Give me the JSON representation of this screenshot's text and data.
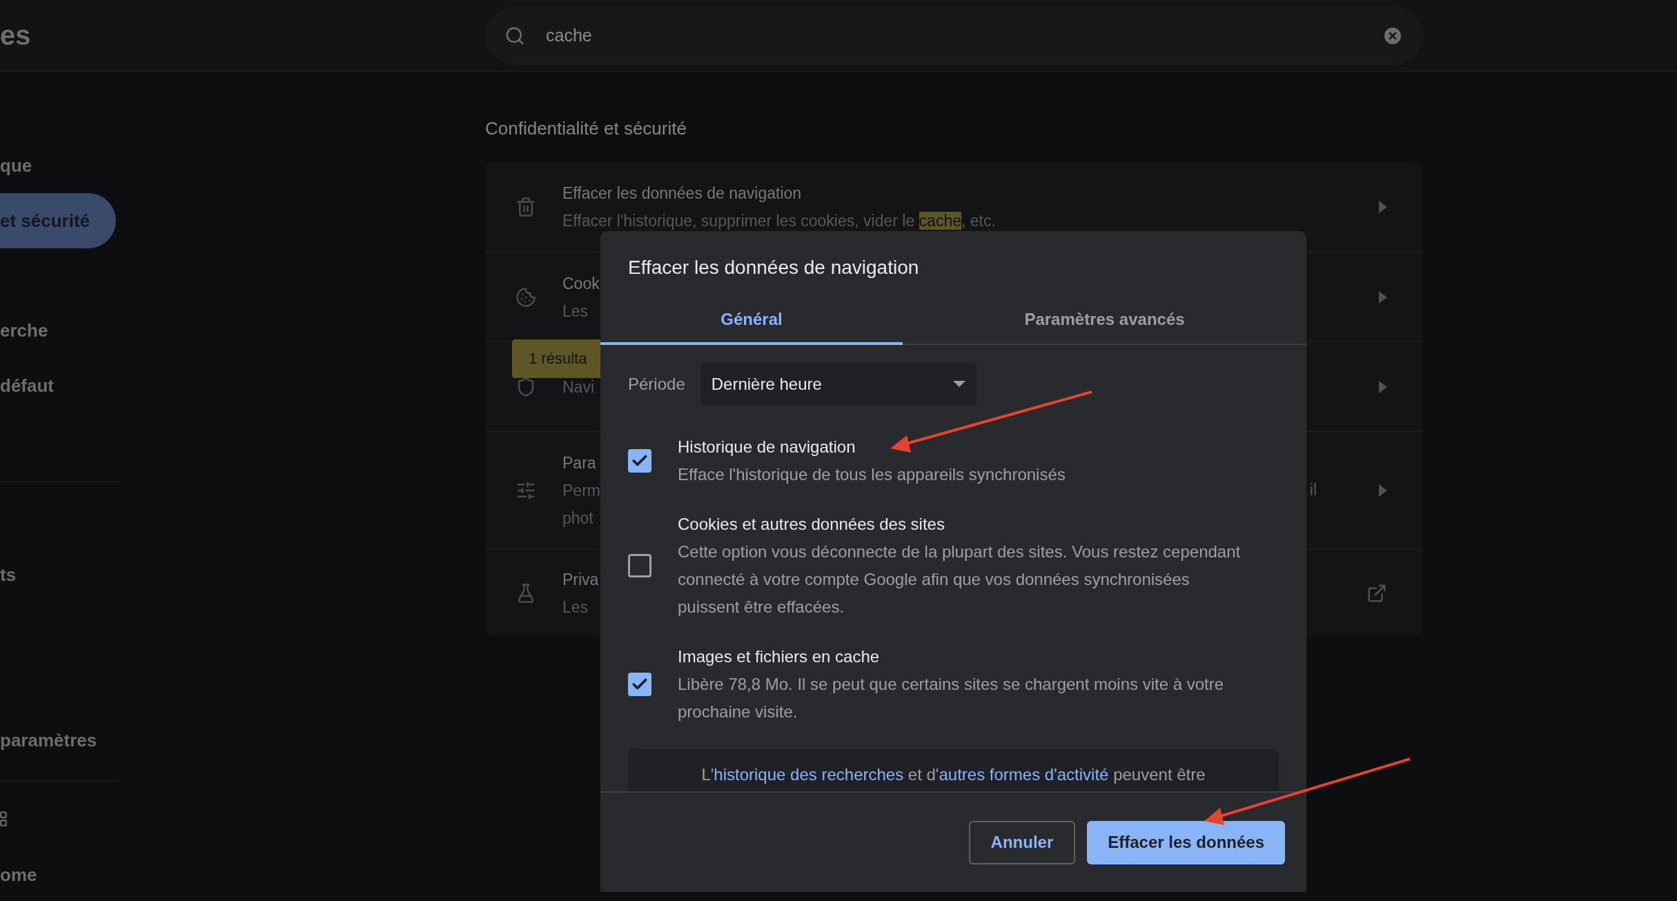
{
  "header": {
    "title": "es",
    "search": {
      "value": "cache"
    }
  },
  "sidebar": {
    "items": [
      {
        "kind": "text",
        "label": "que",
        "selected": false
      },
      {
        "kind": "text",
        "label": "et sécurité",
        "selected": true
      },
      {
        "kind": "text",
        "label": "erche",
        "selected": false
      },
      {
        "kind": "text",
        "label": "défaut",
        "selected": false
      },
      {
        "kind": "text",
        "label": "ts",
        "selected": false
      },
      {
        "kind": "text",
        "label": "paramètres",
        "selected": false
      },
      {
        "kind": "icon",
        "selected": false
      },
      {
        "kind": "text",
        "label": "ome",
        "selected": false
      }
    ]
  },
  "section": {
    "title": "Confidentialité et sécurité",
    "rows": [
      {
        "title": "Effacer les données de navigation",
        "lines": [
          "Effacer l'historique, supprimer les cookies, vider le **cache**, etc."
        ]
      },
      {
        "title": "Cook",
        "lines": [
          "Les"
        ]
      },
      {
        "lines": [
          "Navi"
        ]
      },
      {
        "title": "Para",
        "lines": [
          "Perm",
          "phot"
        ],
        "trailing_text": "il"
      },
      {
        "title": "Priva",
        "lines": [
          "Les"
        ]
      }
    ]
  },
  "search_bubble": {
    "text": "1 résulta"
  },
  "dialog": {
    "title": "Effacer les données de navigation",
    "tabs": [
      {
        "label": "Général",
        "selected": true
      },
      {
        "label": "Paramètres avancés",
        "selected": false
      }
    ],
    "period": {
      "label": "Période",
      "value": "Dernière heure"
    },
    "options": [
      {
        "title": "Historique de navigation",
        "description": "Efface l'historique de tous les appareils synchronisés",
        "checked": true
      },
      {
        "title": "Cookies et autres données des sites",
        "description": "Cette option vous déconnecte de la plupart des sites. Vous restez cependant connecté à votre compte Google afin que vos données synchronisées puissent être effacées.",
        "checked": false
      },
      {
        "title": "Images et fichiers en cache",
        "description": "Libère 78,8 Mo. Il se peut que certains sites se chargent moins vite à votre prochaine visite.",
        "checked": true
      }
    ],
    "notice": {
      "parts": [
        {
          "kind": "text",
          "text": "L'"
        },
        {
          "kind": "link",
          "text": "historique des recherches"
        },
        {
          "kind": "text",
          "text": " et d'"
        },
        {
          "kind": "link",
          "text": "autres formes d'activité"
        },
        {
          "kind": "text",
          "text": " peuvent être"
        }
      ]
    },
    "buttons": [
      {
        "kind": "secondary",
        "label": "Annuler"
      },
      {
        "kind": "primary",
        "label": "Effacer les données"
      }
    ]
  }
}
